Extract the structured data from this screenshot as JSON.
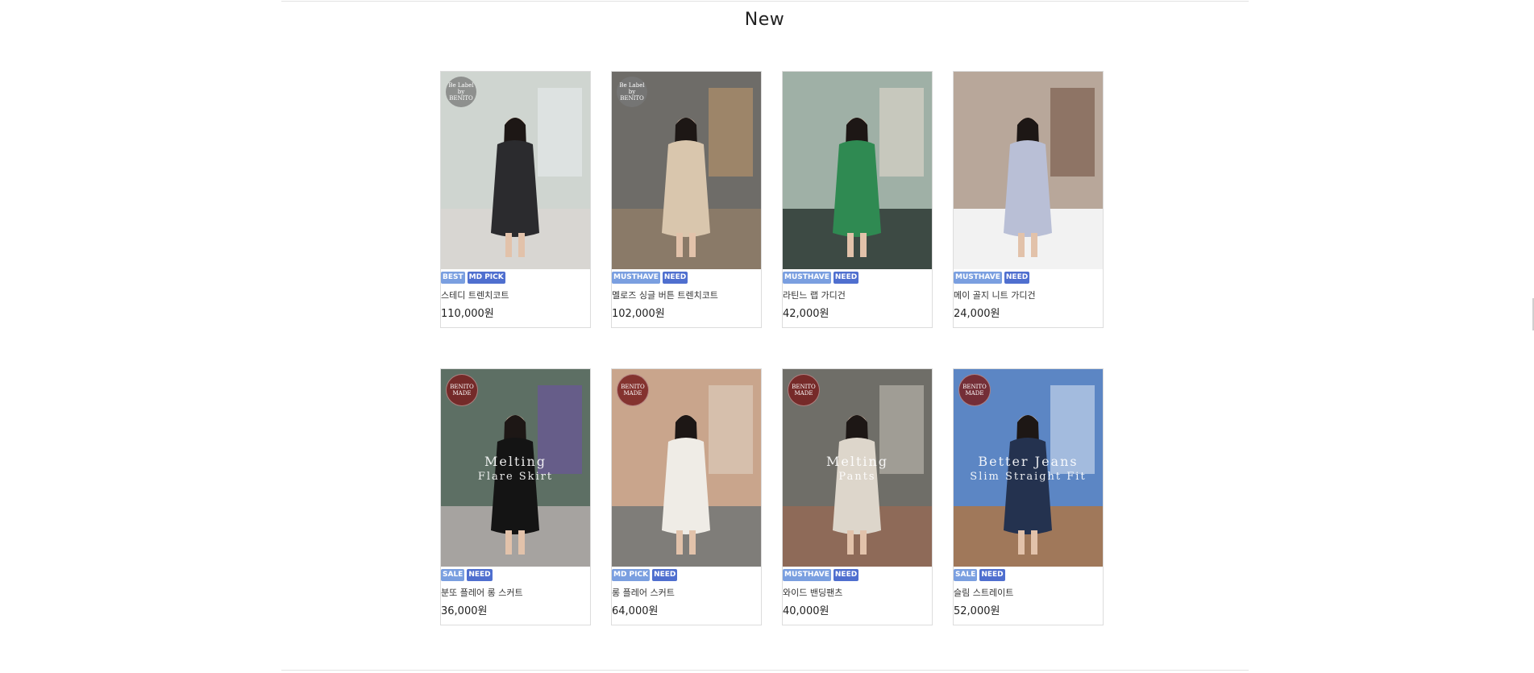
{
  "section": {
    "title": "New"
  },
  "products": [
    {
      "name": "스테디 트렌치코트",
      "price": "110,000원",
      "badges": [
        "BEST",
        "MD PICK"
      ],
      "logo": "Be Label\nby BENITO",
      "logo_style": "grey",
      "overlay": "",
      "overlay2": "",
      "colors": {
        "bg": "#cfd5d0",
        "figure": "#2b2b2e",
        "floor": "#d8d6d2",
        "accent": "#e9ecee"
      }
    },
    {
      "name": "멜로즈 싱글 버튼 트렌치코트",
      "price": "102,000원",
      "badges": [
        "MUSTHAVE",
        "NEED"
      ],
      "logo": "Be Label\nby BENITO",
      "logo_style": "grey",
      "overlay": "",
      "overlay2": "",
      "colors": {
        "bg": "#6e6c68",
        "figure": "#d9c6ad",
        "floor": "#8a7a68",
        "accent": "#c59a6a"
      }
    },
    {
      "name": "라틴느 랩 가디건",
      "price": "42,000원",
      "badges": [
        "MUSTHAVE",
        "NEED"
      ],
      "logo": "",
      "logo_style": "none",
      "overlay": "",
      "overlay2": "",
      "colors": {
        "bg": "#9fb0a6",
        "figure": "#2f8a52",
        "floor": "#3d4a44",
        "accent": "#e8ddd0"
      }
    },
    {
      "name": "메이 골지 니트 가디건",
      "price": "24,000원",
      "badges": [
        "MUSTHAVE",
        "NEED"
      ],
      "logo": "",
      "logo_style": "none",
      "overlay": "",
      "overlay2": "",
      "colors": {
        "bg": "#b8a79a",
        "figure": "#b9bfd6",
        "floor": "#f2f2f2",
        "accent": "#6b4a3a"
      }
    },
    {
      "name": "분또 플레어 롱 스커트",
      "price": "36,000원",
      "badges": [
        "SALE",
        "NEED"
      ],
      "logo": "BENITO\nMADE",
      "logo_style": "red",
      "overlay": "Melting",
      "overlay2": "Flare Skirt",
      "colors": {
        "bg": "#5d6f64",
        "figure": "#141414",
        "floor": "#a6a3a0",
        "accent": "#6d4fa8"
      }
    },
    {
      "name": "롱 플레어 스커트",
      "price": "64,000원",
      "badges": [
        "MD PICK",
        "NEED"
      ],
      "logo": "BENITO\nMADE",
      "logo_style": "red",
      "overlay": "",
      "overlay2": "",
      "colors": {
        "bg": "#c9a58c",
        "figure": "#efece6",
        "floor": "#7f7d79",
        "accent": "#e0d6c6"
      }
    },
    {
      "name": "와이드 밴딩팬츠",
      "price": "40,000원",
      "badges": [
        "MUSTHAVE",
        "NEED"
      ],
      "logo": "BENITO\nMADE",
      "logo_style": "red",
      "overlay": "Melting",
      "overlay2": "Pants",
      "colors": {
        "bg": "#6f6e68",
        "figure": "#ddd6cb",
        "floor": "#8e6a58",
        "accent": "#c9c4ba"
      }
    },
    {
      "name": "슬림 스트레이트",
      "price": "52,000원",
      "badges": [
        "SALE",
        "NEED"
      ],
      "logo": "BENITO\nMADE",
      "logo_style": "red",
      "overlay": "Better Jeans",
      "overlay2": "Slim Straight Fit",
      "colors": {
        "bg": "#5c86c4",
        "figure": "#24324f",
        "floor": "#a0785a",
        "accent": "#dfe8f4"
      }
    }
  ]
}
